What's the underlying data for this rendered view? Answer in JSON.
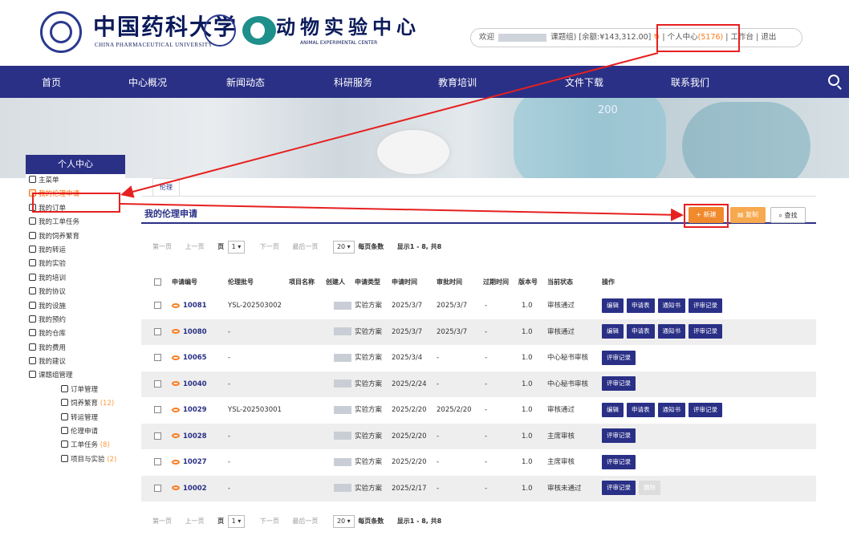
{
  "header": {
    "univ_name": "中国药科大学",
    "univ_name_en": "CHINA PHARMACEUTICAL UNIVERSITY",
    "center_name": "动物实验中心",
    "center_name_en": "ANIMAL EXPERIMENTAL CENTER",
    "welcome": "欢迎",
    "group_suffix": "课题组)",
    "balance_label": "[余额:¥143,312.00]",
    "refresh_icon": "refresh-icon",
    "personal_center": "个人中心",
    "personal_count": "(5176)",
    "workbench": "工作台",
    "logout": "退出",
    "sep": "|"
  },
  "nav": {
    "items": [
      "首页",
      "中心概况",
      "新闻动态",
      "科研服务",
      "教育培训",
      "文件下载",
      "联系我们"
    ],
    "search_icon": "search-icon"
  },
  "banner": {
    "flask_mark": "200"
  },
  "sidebar": {
    "title": "个人中心",
    "items": [
      {
        "label": "主菜单",
        "icon": "home-icon"
      },
      {
        "label": "我的伦理申请",
        "icon": "heart-hand-icon",
        "active": true
      },
      {
        "label": "我的订单",
        "icon": "order-icon"
      },
      {
        "label": "我的工单任务",
        "icon": "task-icon"
      },
      {
        "label": "我的饲养繁育",
        "icon": "mouse-icon"
      },
      {
        "label": "我的转运",
        "icon": "transfer-icon"
      },
      {
        "label": "我的实验",
        "icon": "experiment-icon"
      },
      {
        "label": "我的培训",
        "icon": "training-icon"
      },
      {
        "label": "我的协议",
        "icon": "agreement-icon"
      },
      {
        "label": "我的设施",
        "icon": "facility-icon"
      },
      {
        "label": "我的预约",
        "icon": "clock-icon"
      },
      {
        "label": "我的仓库",
        "icon": "warehouse-icon"
      },
      {
        "label": "我的费用",
        "icon": "fee-icon"
      },
      {
        "label": "我的建议",
        "icon": "suggest-icon"
      },
      {
        "label": "课题组管理",
        "icon": "group-icon"
      }
    ],
    "subitems": [
      {
        "label": "订单管理",
        "count": ""
      },
      {
        "label": "饲养繁育",
        "count": "(12)"
      },
      {
        "label": "转运管理",
        "count": ""
      },
      {
        "label": "伦理申请",
        "count": ""
      },
      {
        "label": "工单任务",
        "count": "(8)"
      },
      {
        "label": "项目与实验",
        "count": "(2)"
      }
    ]
  },
  "main": {
    "tab_label": "伦理",
    "page_title": "我的伦理申请",
    "btn_new": "+ 新建",
    "btn_copy": "复制",
    "btn_search": "查找",
    "pager": {
      "first": "第一页",
      "prev": "上一页",
      "page_label": "页",
      "page_value": "1 ▾",
      "next": "下一页",
      "last": "最后一页",
      "per_page_value": "20 ▾",
      "per_page_label": "每页条数",
      "summary": "显示1 - 8, 共8"
    },
    "columns": [
      "申请编号",
      "伦理批号",
      "项目名称",
      "创建人",
      "申请类型",
      "申请时间",
      "审批时间",
      "过期时间",
      "版本号",
      "当前状态",
      "操作"
    ],
    "rows": [
      {
        "id": "10081",
        "batch": "YSL-202503002",
        "type": "实验方案",
        "apply": "2025/3/7",
        "approve": "2025/3/7",
        "expire": "-",
        "ver": "1.0",
        "status": "审核通过",
        "actions": [
          "编辑",
          "申请表",
          "通知书",
          "评审记录"
        ]
      },
      {
        "id": "10080",
        "batch": "-",
        "type": "实验方案",
        "apply": "2025/3/7",
        "approve": "2025/3/7",
        "expire": "-",
        "ver": "1.0",
        "status": "审核通过",
        "actions": [
          "编辑",
          "申请表",
          "通知书",
          "评审记录"
        ]
      },
      {
        "id": "10065",
        "batch": "-",
        "type": "实验方案",
        "apply": "2025/3/4",
        "approve": "-",
        "expire": "-",
        "ver": "1.0",
        "status": "中心秘书审核",
        "actions": [
          "评审记录"
        ]
      },
      {
        "id": "10040",
        "batch": "-",
        "type": "实验方案",
        "apply": "2025/2/24",
        "approve": "-",
        "expire": "-",
        "ver": "1.0",
        "status": "中心秘书审核",
        "actions": [
          "评审记录"
        ]
      },
      {
        "id": "10029",
        "batch": "YSL-202503001",
        "type": "实验方案",
        "apply": "2025/2/20",
        "approve": "2025/2/20",
        "expire": "-",
        "ver": "1.0",
        "status": "审核通过",
        "actions": [
          "编辑",
          "申请表",
          "通知书",
          "评审记录"
        ]
      },
      {
        "id": "10028",
        "batch": "-",
        "type": "实验方案",
        "apply": "2025/2/20",
        "approve": "-",
        "expire": "-",
        "ver": "1.0",
        "status": "主席审核",
        "actions": [
          "评审记录"
        ]
      },
      {
        "id": "10027",
        "batch": "-",
        "type": "实验方案",
        "apply": "2025/2/20",
        "approve": "-",
        "expire": "-",
        "ver": "1.0",
        "status": "主席审核",
        "actions": [
          "评审记录"
        ]
      },
      {
        "id": "10002",
        "batch": "-",
        "type": "实验方案",
        "apply": "2025/2/17",
        "approve": "-",
        "expire": "-",
        "ver": "1.0",
        "status": "审核未通过",
        "actions": [
          "评审记录",
          "删除"
        ]
      }
    ]
  },
  "colors": {
    "nav_bg": "#2a3086",
    "accent": "#f08a2c",
    "highlight": "#e62020"
  }
}
